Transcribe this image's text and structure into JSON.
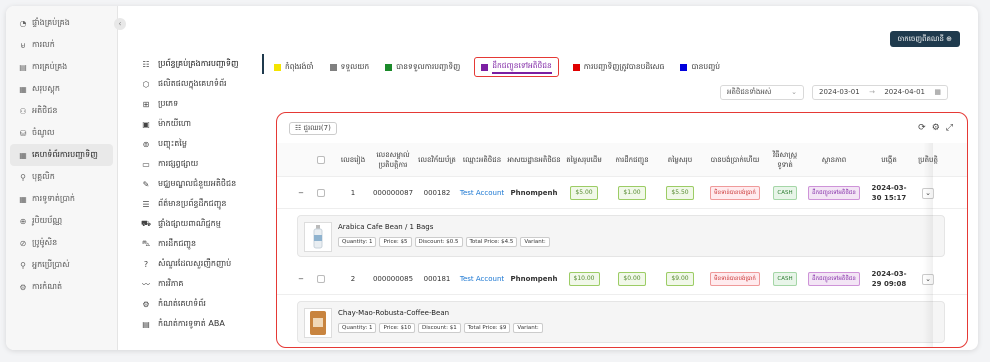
{
  "sidebar": {
    "items": [
      {
        "icon": "dashboard-icon",
        "glyph": "◔",
        "label": "ផ្ទាំងគ្រប់គ្រង"
      },
      {
        "icon": "sale-icon",
        "glyph": "⊌",
        "label": "ការលក់"
      },
      {
        "icon": "product-icon",
        "glyph": "▤",
        "label": "ការគ្រប់គ្រង"
      },
      {
        "icon": "stock-icon",
        "glyph": "▦",
        "label": "សរុបស្តុក"
      },
      {
        "icon": "customer-icon",
        "glyph": "⚇",
        "label": "អតិថិជន"
      },
      {
        "icon": "report-icon",
        "glyph": "⛁",
        "label": "ចំណូល"
      },
      {
        "icon": "order-icon",
        "glyph": "▦",
        "label": "គេហទំព័រការបញ្ជាទិញ"
      },
      {
        "icon": "user-icon",
        "glyph": "⚲",
        "label": "បុគ្គលិក"
      },
      {
        "icon": "payment-icon",
        "glyph": "▦",
        "label": "ការទូទាត់ប្រាក់"
      },
      {
        "icon": "currency-icon",
        "glyph": "⊕",
        "label": "រូបិយប័ណ្ណ"
      },
      {
        "icon": "promotion-icon",
        "glyph": "⊘",
        "label": "ប្រូម៉ូសិន"
      },
      {
        "icon": "staff-icon",
        "glyph": "⚲",
        "label": "អ្នកប្រើប្រាស់"
      },
      {
        "icon": "settings-icon",
        "glyph": "⚙",
        "label": "ការកំណត់"
      }
    ],
    "active_index": 6
  },
  "topbar": {
    "account_button": "ចាកចេញពីគណនី ⊕"
  },
  "submenu": {
    "items": [
      {
        "glyph": "☷",
        "label": "ប្រព័ន្ធគ្រប់គ្រងការបញ្ជាទិញ"
      },
      {
        "glyph": "⬡",
        "label": "ផលិតផលក្នុងគេហទំព័រ"
      },
      {
        "glyph": "⊞",
        "label": "ប្រភេទ"
      },
      {
        "glyph": "▣",
        "label": "ម៉ាកយីហោ"
      },
      {
        "glyph": "⊚",
        "label": "បញ្ចុះតម្លៃ"
      },
      {
        "glyph": "▭",
        "label": "ការផ្សព្វផ្សាយ"
      },
      {
        "glyph": "✎",
        "label": "មជ្ឈមណ្ឌលជំនួយអតិថិជន"
      },
      {
        "glyph": "☰",
        "label": "ព័ត៌មានប្រព័ន្ធដឹកជញ្ជូន"
      },
      {
        "glyph": "⛟",
        "label": "ផ្ទាំងផ្សាយពាណិជ្ជកម្ម"
      },
      {
        "glyph": "⛍",
        "label": "ការដឹកជញ្ជូន"
      },
      {
        "glyph": "?",
        "label": "សំណួរដែលសួរញឹកញាប់"
      },
      {
        "glyph": "〰",
        "label": "ការវិភាគ"
      },
      {
        "glyph": "⚙",
        "label": "កំណត់គេហទំព័រ"
      },
      {
        "glyph": "▤",
        "label": "កំណត់ការទូទាត់ ABA"
      }
    ],
    "active_index": 0
  },
  "status_filters": [
    {
      "color": "#f4e400",
      "label": "កំពុងរង់ចាំ"
    },
    {
      "color": "#808080",
      "label": "ទទួលយក"
    },
    {
      "color": "#1b8a2a",
      "label": "បានទទួលការបញ្ជាទិញ"
    },
    {
      "color": "#7b1fa2",
      "label": "ដឹកជញ្ជូនទៅអតិថិជន"
    },
    {
      "color": "#e00000",
      "label": "ការបញ្ជាទិញត្រូវបានបដិសេធ"
    },
    {
      "color": "#0000dd",
      "label": "បានបញ្ចប់"
    }
  ],
  "selected_filter_index": 3,
  "date_filter": {
    "type": "អតិថិជនទាំងអស់",
    "start": "2024-03-01",
    "end": "2024-04-01",
    "arrow": "→",
    "calendar_icon": "calendar-icon"
  },
  "table": {
    "columns_button": "☷ ជួរឈរ(7)",
    "tool_icons": [
      "⟳",
      "⚙",
      "⤢"
    ],
    "headers": [
      "",
      "",
      "លេខរៀង",
      "លេខសម្គាល់ប្រតិបត្តិការ",
      "លេខវិក័យប័ត្រ",
      "ឈ្មោះអតិថិជន",
      "អាសយដ្ឋានអតិថិជន",
      "តម្លៃសរុបដើម",
      "ការដឹកជញ្ជូន",
      "តម្លៃសរុប",
      "បានបង់ប្រាក់ហើយ",
      "វិធីសាស្រ្តទូទាត់",
      "ស្ថានភាព",
      "បង្កើត",
      "ប្រតិបត្តិ"
    ],
    "rows": [
      {
        "expand": "−",
        "no": "1",
        "txn": "000000087",
        "invoice": "000182",
        "customer": "Test Account",
        "address": "Phnompenh",
        "subtotal": "$5.00",
        "delivery": "$1.00",
        "total": "$5.50",
        "paid": "មិនទាន់បានបង់ប្រាក់",
        "method": "CASH",
        "status": "ដឹកជញ្ជូនទៅអតិថិជន",
        "created": "2024-03-30 15:17",
        "action": "⌄",
        "item": {
          "name": "Arabica Cafe Bean / 1 Bags",
          "chips": [
            "Quantity: 1",
            "Price: $5",
            "Discount: $0.5",
            "Total Price: $4.5",
            "Variant:"
          ]
        }
      },
      {
        "expand": "−",
        "no": "2",
        "txn": "000000085",
        "invoice": "000181",
        "customer": "Test Account",
        "address": "Phnompenh",
        "subtotal": "$10.00",
        "delivery": "$0.00",
        "total": "$9.00",
        "paid": "មិនទាន់បានបង់ប្រាក់",
        "method": "CASH",
        "status": "ដឹកជញ្ជូនទៅអតិថិជន",
        "created": "2024-03-29 09:08",
        "action": "⌄",
        "item": {
          "name": "Chay-Mao-Robusta-Coffee-Bean",
          "chips": [
            "Quantity: 1",
            "Price: $10",
            "Discount: $1",
            "Total Price: $9",
            "Variant:"
          ]
        }
      }
    ]
  }
}
